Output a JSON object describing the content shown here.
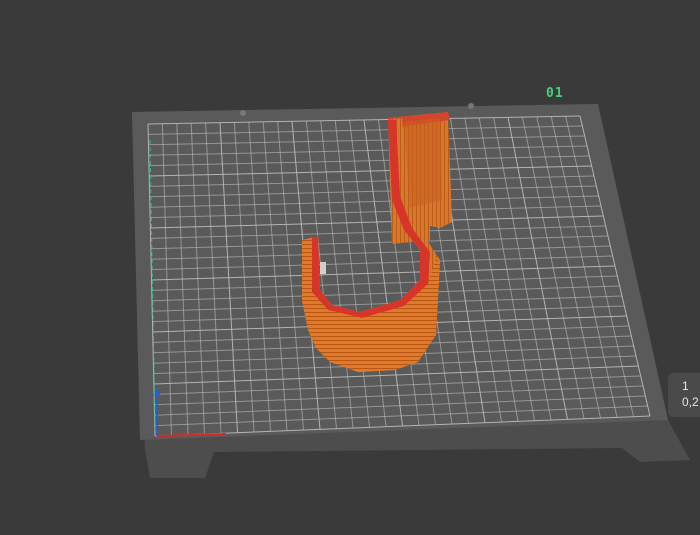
{
  "viewport": {
    "plate_label": "01",
    "layer_indicator": {
      "layer": "1",
      "height": "0,2"
    }
  },
  "colors": {
    "background": "#3a3a3a",
    "plate": "#555555",
    "grid": "#bdbdbd",
    "model": "#e07a2a",
    "model_top": "#d8352a",
    "plate_label": "#3fd27a",
    "axis_x": "#d12b2b",
    "axis_y": "#2bd182",
    "axis_z": "#2b5bd1"
  },
  "icons": [
    "build-plate-3d",
    "axis-gizmo-icon"
  ]
}
